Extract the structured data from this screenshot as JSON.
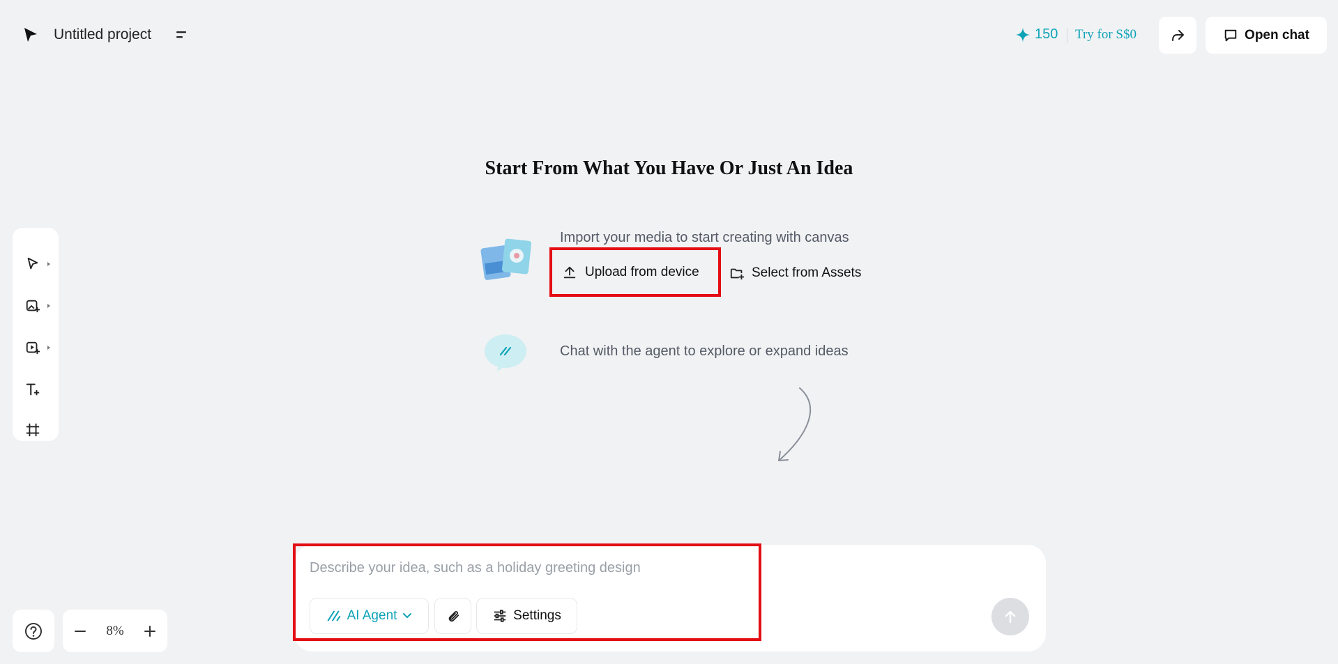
{
  "header": {
    "project_title": "Untitled project",
    "credits": "150",
    "try_label": "Try for S$0",
    "open_chat_label": "Open chat"
  },
  "toolbar": {
    "tools": [
      {
        "name": "select-tool",
        "icon": "cursor-icon"
      },
      {
        "name": "add-image-tool",
        "icon": "image-plus-icon"
      },
      {
        "name": "add-video-tool",
        "icon": "video-plus-icon"
      },
      {
        "name": "add-text-tool",
        "icon": "text-plus-icon"
      },
      {
        "name": "frame-tool",
        "icon": "frame-icon"
      }
    ]
  },
  "main": {
    "headline": "Start From What You Have Or Just An Idea",
    "import_text": "Import your media to start creating with canvas",
    "upload_label": "Upload from device",
    "assets_label": "Select from Assets",
    "chat_text": "Chat with the agent to explore or expand ideas"
  },
  "composer": {
    "placeholder": "Describe your idea, such as a holiday greeting design",
    "agent_label": "AI Agent",
    "settings_label": "Settings"
  },
  "zoom": {
    "value": "8%"
  },
  "colors": {
    "accent": "#0fa3b8",
    "highlight": "#e30d13",
    "background": "#f1f2f4"
  }
}
